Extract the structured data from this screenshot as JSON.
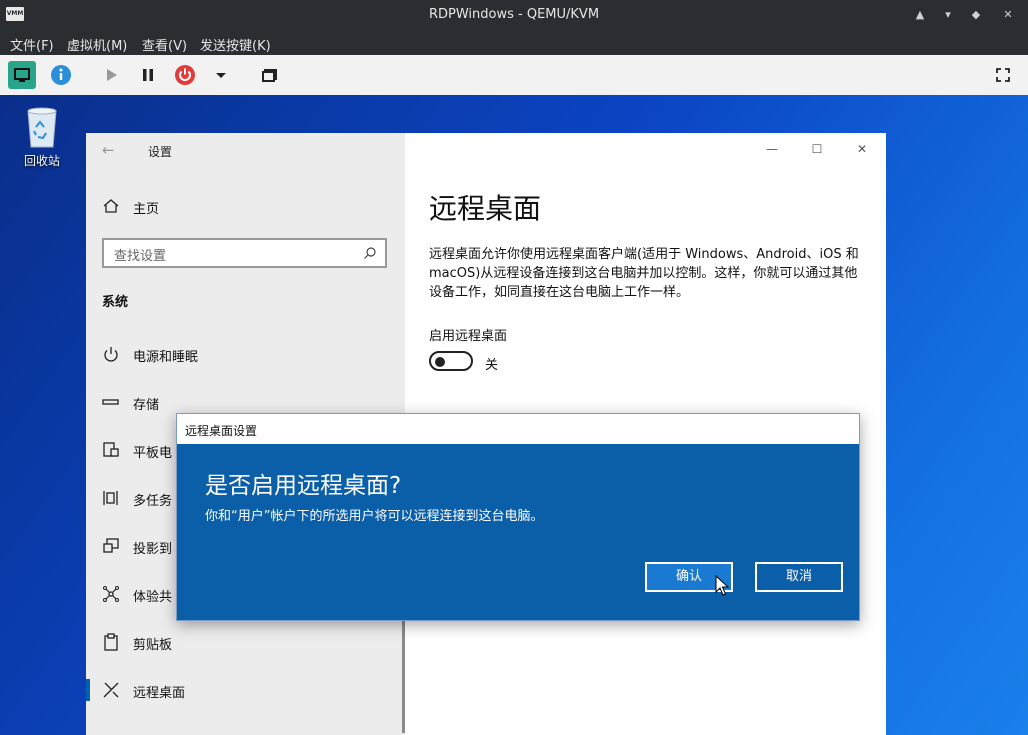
{
  "window": {
    "title": "RDPWindows - QEMU/KVM",
    "app_icon_text": "VMM"
  },
  "menu": [
    "文件(F)",
    "虚拟机(M)",
    "查看(V)",
    "发送按键(K)"
  ],
  "desktop": {
    "recycle_bin_label": "回收站"
  },
  "settings": {
    "header": "设置",
    "home": "主页",
    "search_placeholder": "查找设置",
    "section": "系统",
    "nav_items": [
      {
        "label": "电源和睡眠",
        "icon": "power-icon"
      },
      {
        "label": "存储",
        "icon": "storage-icon"
      },
      {
        "label": "平板电",
        "icon": "tablet-icon"
      },
      {
        "label": "多任务",
        "icon": "multitask-icon"
      },
      {
        "label": "投影到",
        "icon": "projection-icon"
      },
      {
        "label": "体验共",
        "icon": "share-icon"
      },
      {
        "label": "剪贴板",
        "icon": "clipboard-icon"
      },
      {
        "label": "远程桌面",
        "icon": "remote-desktop-icon"
      }
    ],
    "page_title": "远程桌面",
    "description": "远程桌面允许你使用远程桌面客户端(适用于 Windows、Android、iOS 和 macOS)从远程设备连接到这台电脑并加以控制。这样，你就可以通过其他设备工作，如同直接在这台电脑上工作一样。",
    "enable_label": "启用远程桌面",
    "toggle_state": "关"
  },
  "dialog": {
    "title": "远程桌面设置",
    "question": "是否启用远程桌面?",
    "message": "你和“用户”帐户下的所选用户将可以远程连接到这台电脑。",
    "ok_label": "确认",
    "cancel_label": "取消"
  },
  "colors": {
    "dialog_bg": "#0b5ea8",
    "accent": "#0063b1",
    "toolbar_active": "#28a58a"
  }
}
